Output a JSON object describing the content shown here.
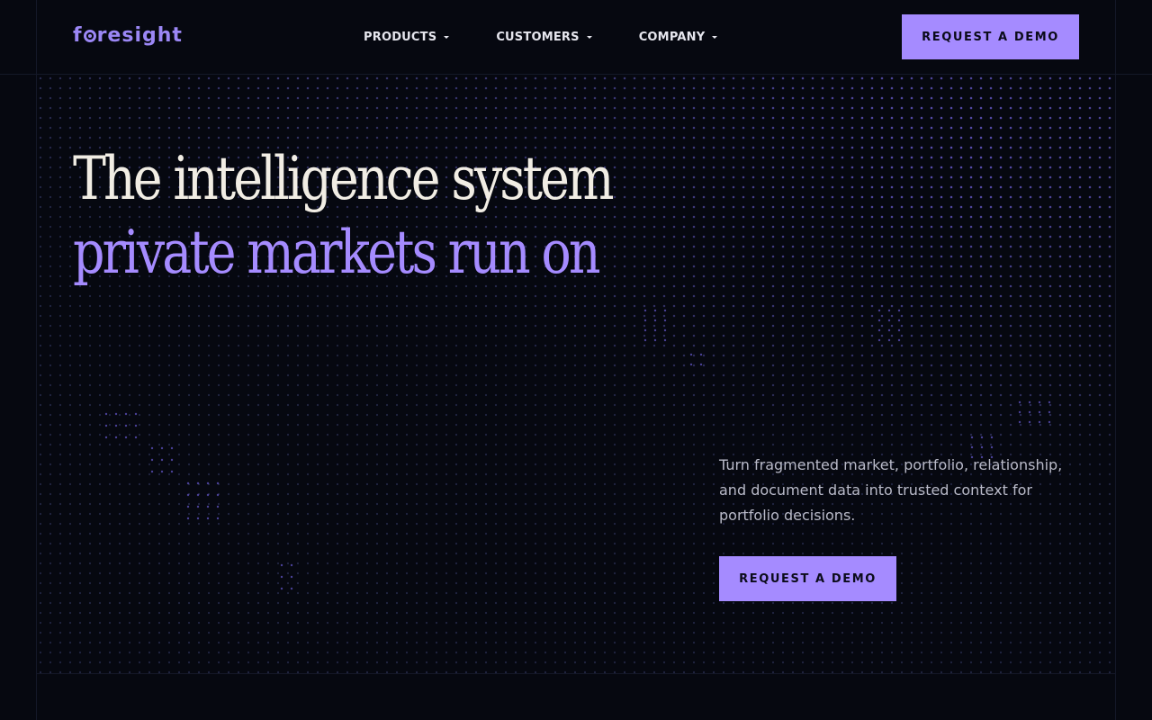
{
  "brand": {
    "logo_text_before": "f",
    "logo_text_after": "resight",
    "accent_color": "#a58bff"
  },
  "nav": {
    "items": [
      {
        "label": "PRODUCTS"
      },
      {
        "label": "CUSTOMERS"
      },
      {
        "label": "COMPANY"
      }
    ]
  },
  "header": {
    "cta_label": "REQUEST A DEMO"
  },
  "hero": {
    "headline_line1": "The intelligence system",
    "headline_line2": "private markets run on",
    "subtext": "Turn fragmented market, portfolio, relationship, and document data into trusted context for portfolio decisions.",
    "cta_label": "REQUEST A DEMO"
  }
}
